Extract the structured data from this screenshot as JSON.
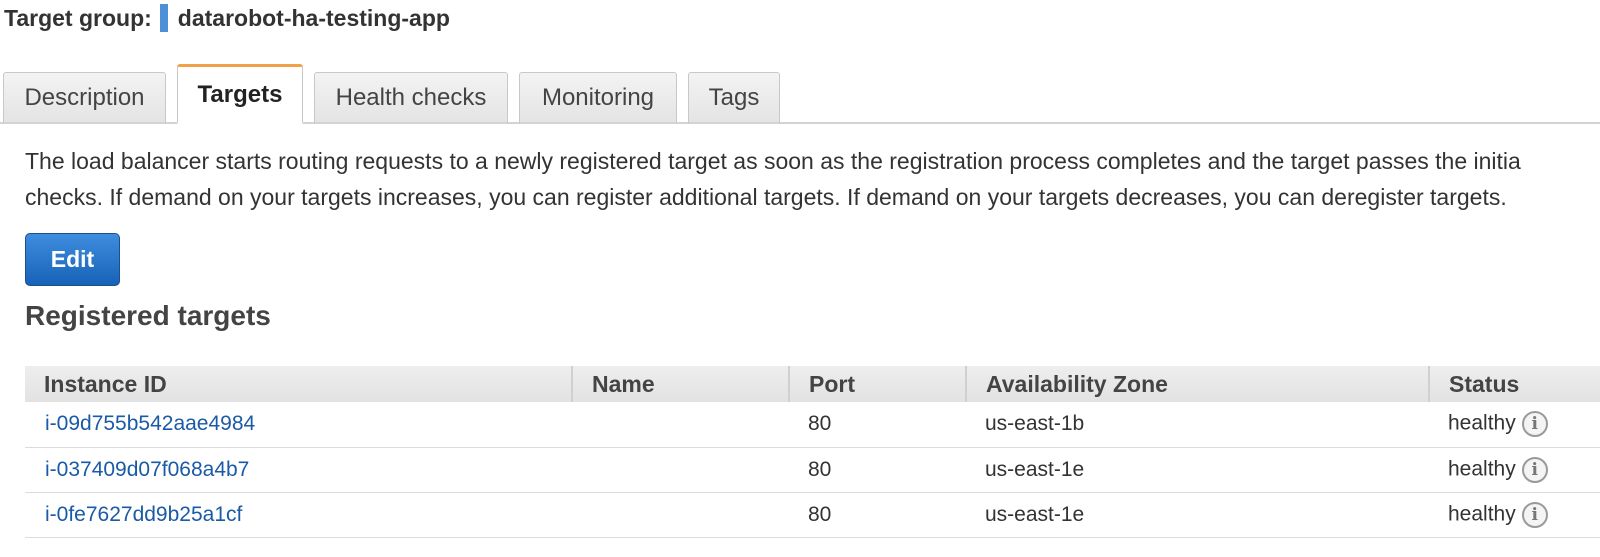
{
  "header": {
    "label": "Target group:",
    "name": "datarobot-ha-testing-app"
  },
  "tabs": [
    {
      "label": "Description",
      "active": false
    },
    {
      "label": "Targets",
      "active": true
    },
    {
      "label": "Health checks",
      "active": false
    },
    {
      "label": "Monitoring",
      "active": false
    },
    {
      "label": "Tags",
      "active": false
    }
  ],
  "description": {
    "line1": "The load balancer starts routing requests to a newly registered target as soon as the registration process completes and the target passes the initia",
    "line2": "checks. If demand on your targets increases, you can register additional targets. If demand on your targets decreases, you can deregister targets."
  },
  "edit_button": {
    "label": "Edit"
  },
  "registered_targets": {
    "title": "Registered targets",
    "columns": [
      "Instance ID",
      "Name",
      "Port",
      "Availability Zone",
      "Status"
    ],
    "rows": [
      {
        "instance_id": "i-09d755b542aae4984",
        "name": "",
        "port": "80",
        "zone": "us-east-1b",
        "status": "healthy"
      },
      {
        "instance_id": "i-037409d07f068a4b7",
        "name": "",
        "port": "80",
        "zone": "us-east-1e",
        "status": "healthy"
      },
      {
        "instance_id": "i-0fe7627dd9b25a1cf",
        "name": "",
        "port": "80",
        "zone": "us-east-1e",
        "status": "healthy"
      }
    ]
  },
  "icons": {
    "status_info": "info-icon"
  },
  "colors": {
    "active_tab_accent": "#f0a14a",
    "primary_button": "#1662b8",
    "link": "#1a5aa6",
    "header_marker": "#4f8fd8"
  }
}
